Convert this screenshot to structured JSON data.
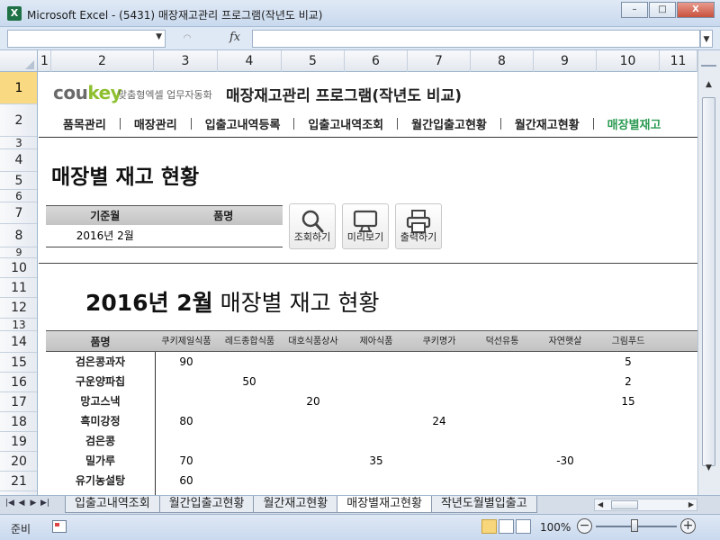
{
  "window": {
    "title": "Microsoft Excel - (5431) 매장재고관리 프로그램(작년도 비교)",
    "controls": {
      "minimize": "–",
      "maximize": "□",
      "close": "X"
    }
  },
  "formula_bar": {
    "name_box": "",
    "fx": "fx",
    "formula": "",
    "fx_icon": "fx-icon"
  },
  "columns": [
    "1",
    "2",
    "3",
    "4",
    "5",
    "6",
    "7",
    "8",
    "9",
    "10",
    "11"
  ],
  "rows": [
    "1",
    "2",
    "3",
    "4",
    "5",
    "6",
    "7",
    "8",
    "9",
    "10",
    "11",
    "12",
    "13",
    "14",
    "15",
    "16",
    "17",
    "18",
    "19",
    "20",
    "21"
  ],
  "sheet": {
    "logo": {
      "brand_a": "cou",
      "brand_b": "key",
      "tagline": "맞춤형엑셀 업무자동화"
    },
    "program_title": "매장재고관리 프로그램(작년도 비교)",
    "nav": [
      "품목관리",
      "매장관리",
      "입출고내역등록",
      "입출고내역조회",
      "월간입출고현황",
      "월간재고현황",
      "매장별재고"
    ],
    "page_heading": "매장별 재고 현황",
    "filter": {
      "headers": [
        "기준월",
        "품명"
      ],
      "values": [
        "2016년 2월",
        ""
      ]
    },
    "buttons": [
      {
        "label": "조회하기",
        "icon": "search-icon"
      },
      {
        "label": "미리보기",
        "icon": "monitor-icon"
      },
      {
        "label": "출력하기",
        "icon": "printer-icon"
      }
    ],
    "report": {
      "period": "2016년 2월",
      "title": "매장별 재고 현황"
    },
    "table": {
      "name_header": "품명",
      "store_headers": [
        "쿠키제일식품",
        "레드종합식품",
        "대호식품상사",
        "제아식품",
        "쿠키명가",
        "덕선유통",
        "자연햇살",
        "그림푸드"
      ],
      "rows": [
        {
          "name": "검은콩과자",
          "values": [
            "90",
            "",
            "",
            "",
            "",
            "",
            "",
            "5"
          ]
        },
        {
          "name": "구운양파칩",
          "values": [
            "",
            "50",
            "",
            "",
            "",
            "",
            "",
            "2"
          ]
        },
        {
          "name": "망고스낵",
          "values": [
            "",
            "",
            "20",
            "",
            "",
            "",
            "",
            "15"
          ]
        },
        {
          "name": "흑미강정",
          "values": [
            "80",
            "",
            "",
            "",
            "24",
            "",
            "",
            ""
          ]
        },
        {
          "name": "검은콩",
          "values": [
            "",
            "",
            "",
            "",
            "",
            "",
            "",
            ""
          ]
        },
        {
          "name": "밀가루",
          "values": [
            "70",
            "",
            "",
            "35",
            "",
            "",
            "-30",
            ""
          ]
        },
        {
          "name": "유기농설탕",
          "values": [
            "60",
            "",
            "",
            "",
            "",
            "",
            "",
            ""
          ]
        }
      ]
    }
  },
  "tabs": {
    "nav_arrows": [
      "|◀",
      "◀",
      "▶",
      "▶|"
    ],
    "items": [
      "입출고내역조회",
      "월간입출고현황",
      "월간재고현황",
      "매장별재고현황",
      "작년도월별입출고"
    ],
    "active_index": 3
  },
  "status": {
    "ready": "준비",
    "zoom": "100%",
    "zoom_minus": "−",
    "zoom_plus": "+"
  }
}
